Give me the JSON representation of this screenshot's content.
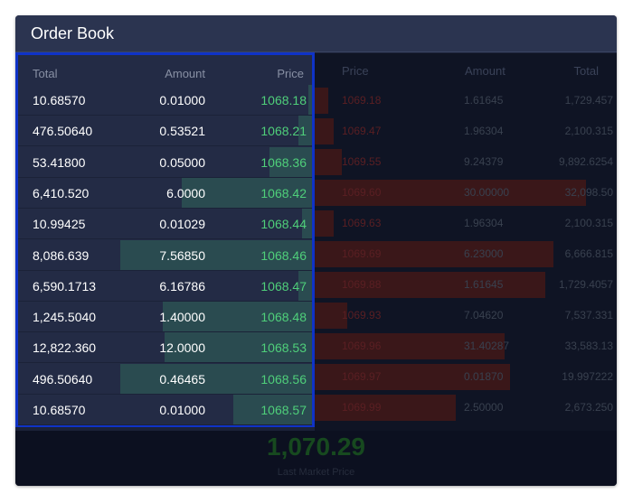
{
  "panel": {
    "title": "Order Book"
  },
  "bids": {
    "headers": {
      "total": "Total",
      "amount": "Amount",
      "price": "Price"
    },
    "rows": [
      {
        "total": "10.68570",
        "amount": "0.01000",
        "price": "1068.18",
        "depth": 0.02
      },
      {
        "total": "476.50640",
        "amount": "0.53521",
        "price": "1068.21",
        "depth": 0.07
      },
      {
        "total": "53.41800",
        "amount": "0.05000",
        "price": "1068.36",
        "depth": 0.22
      },
      {
        "total": "6,410.520",
        "amount": "6.0000",
        "price": "1068.42",
        "depth": 0.68
      },
      {
        "total": "10.99425",
        "amount": "0.01029",
        "price": "1068.44",
        "depth": 0.05
      },
      {
        "total": "8,086.639",
        "amount": "7.56850",
        "price": "1068.46",
        "depth": 1.0
      },
      {
        "total": "6,590.1713",
        "amount": "6.16786",
        "price": "1068.47",
        "depth": 0.07
      },
      {
        "total": "1,245.5040",
        "amount": "1.40000",
        "price": "1068.48",
        "depth": 0.78
      },
      {
        "total": "12,822.360",
        "amount": "12.0000",
        "price": "1068.53",
        "depth": 0.77
      },
      {
        "total": "496.50640",
        "amount": "0.46465",
        "price": "1068.56",
        "depth": 1.0
      },
      {
        "total": "10.68570",
        "amount": "0.01000",
        "price": "1068.57",
        "depth": 0.41
      }
    ]
  },
  "asks": {
    "headers": {
      "price": "Price",
      "amount": "Amount",
      "total": "Total"
    },
    "rows": [
      {
        "price": "1069.18",
        "amount": "1.61645",
        "total": "1,729.457",
        "depth": 0.05
      },
      {
        "price": "1069.47",
        "amount": "1.96304",
        "total": "2,100.315",
        "depth": 0.07
      },
      {
        "price": "1069.55",
        "amount": "9.24379",
        "total": "9,892.6254",
        "depth": 0.1
      },
      {
        "price": "1069.60",
        "amount": "30.00000",
        "total": "32,098.50",
        "depth": 1.0
      },
      {
        "price": "1069.63",
        "amount": "1.96304",
        "total": "2,100.315",
        "depth": 0.07
      },
      {
        "price": "1069.69",
        "amount": "6.23000",
        "total": "6,666.815",
        "depth": 0.88
      },
      {
        "price": "1069.88",
        "amount": "1.61645",
        "total": "1,729.4057",
        "depth": 0.85
      },
      {
        "price": "1069.93",
        "amount": "7.04620",
        "total": "7,537.331",
        "depth": 0.12
      },
      {
        "price": "1069.96",
        "amount": "31.40287",
        "total": "33,583.13",
        "depth": 0.7
      },
      {
        "price": "1069.97",
        "amount": "0.01870",
        "total": "19.997222",
        "depth": 0.72
      },
      {
        "price": "1069.99",
        "amount": "2.50000",
        "total": "2,673.250",
        "depth": 0.52
      }
    ]
  },
  "last_price": {
    "value": "1,070.29",
    "label": "Last Market Price"
  },
  "colors": {
    "bid_price": "#4fcf7a",
    "bid_depth": "#2a4b50",
    "ask_depth": "#3a1719",
    "highlight_border": "#0f33c7"
  }
}
